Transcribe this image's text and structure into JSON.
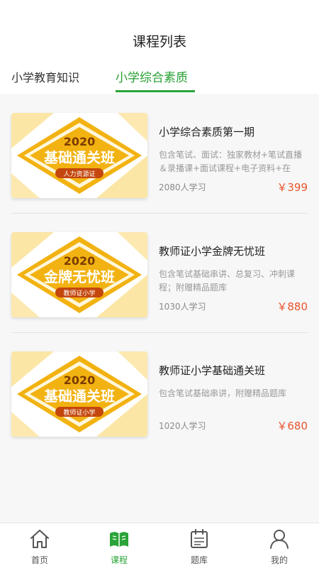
{
  "header": {
    "title": "课程列表"
  },
  "tabs": [
    {
      "label": "小学教育知识"
    },
    {
      "label": "小学综合素质"
    }
  ],
  "courses": [
    {
      "title": "小学综合素质第一期",
      "description": "包含笔试、面试：独家教材+笔试直播＆录播课+面试课程+电子资料+在线…",
      "students": "2080人学习",
      "price": "￥399",
      "banner": {
        "year": "2020",
        "headline": "基础通关班",
        "tag": "人力资源证"
      }
    },
    {
      "title": "教师证小学金牌无忧班",
      "description": "包含笔试基础串讲、总复习、冲刺课程；附赠精品题库",
      "students": "1030人学习",
      "price": "￥880",
      "banner": {
        "year": "2020",
        "headline": "金牌无忧班",
        "tag": "教师证小学"
      }
    },
    {
      "title": "教师证小学基础通关班",
      "description": "包含笔试基础串讲，附赠精品题库",
      "students": "1020人学习",
      "price": "￥680",
      "banner": {
        "year": "2020",
        "headline": "基础通关班",
        "tag": "教师证小学"
      }
    }
  ],
  "tabbar": [
    {
      "label": "首页",
      "icon": "home-icon"
    },
    {
      "label": "课程",
      "icon": "book-icon"
    },
    {
      "label": "题库",
      "icon": "calendar-icon"
    },
    {
      "label": "我的",
      "icon": "user-icon"
    }
  ],
  "colors": {
    "accent": "#2aa438",
    "price": "#e9542d",
    "banner": "#f2b211"
  }
}
